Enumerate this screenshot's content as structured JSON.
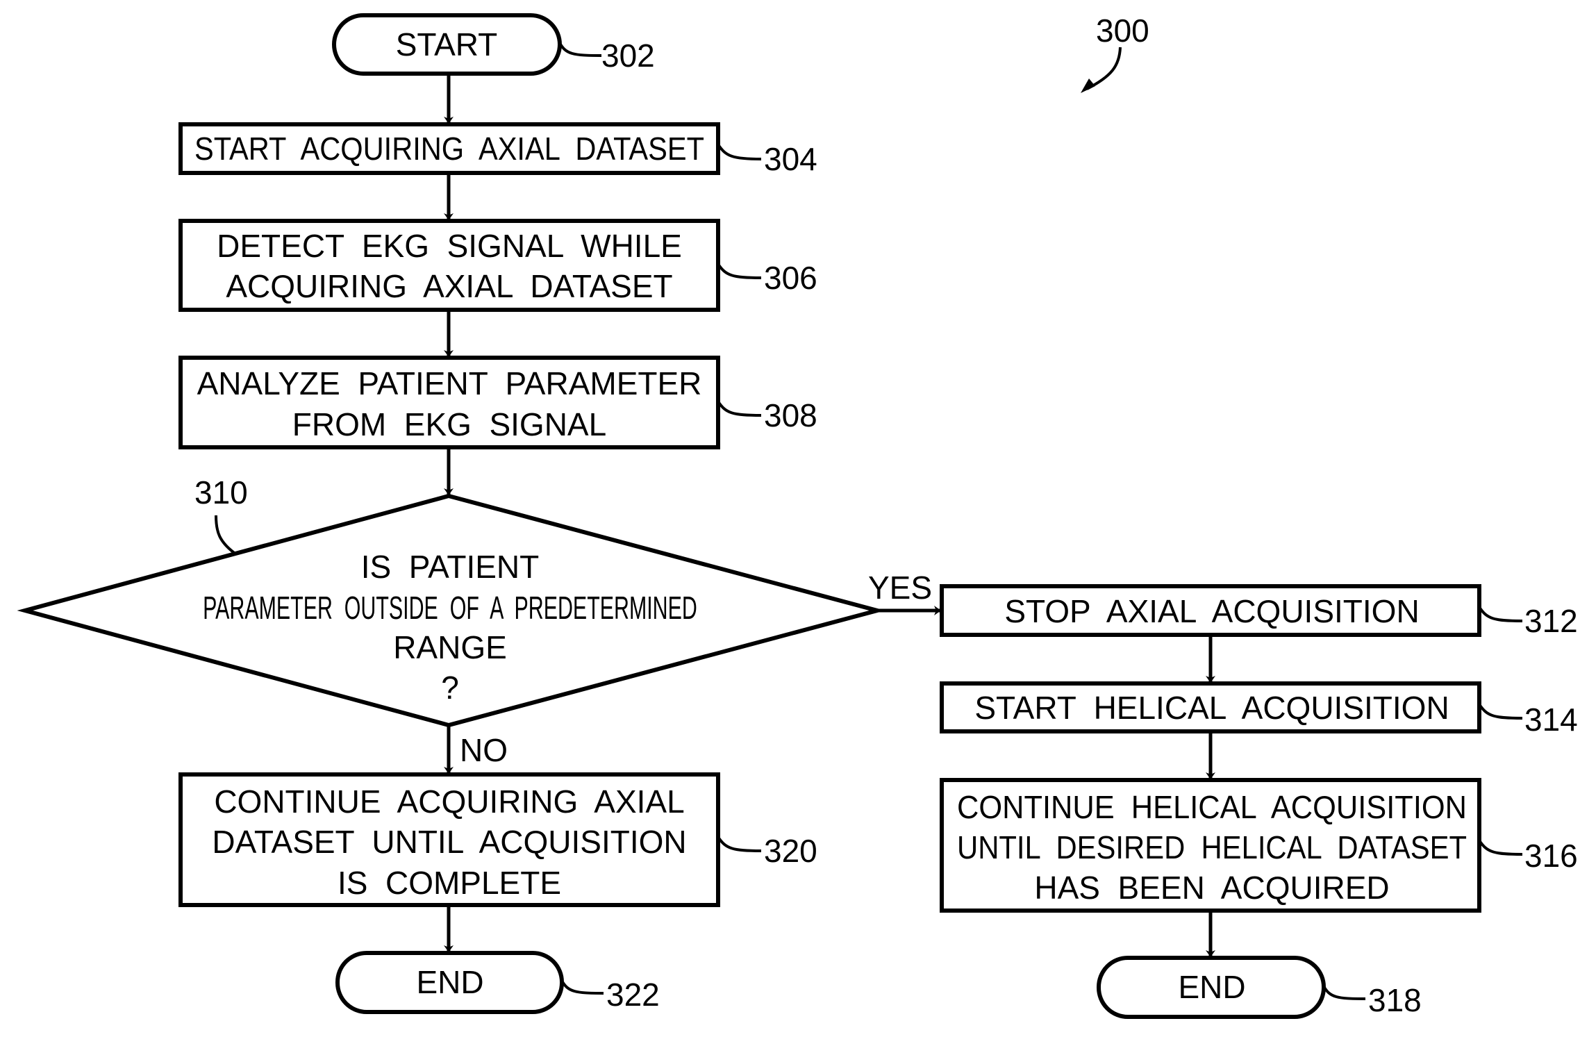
{
  "figure": {
    "ref": "300"
  },
  "nodes": {
    "start": {
      "ref": "302",
      "lines": [
        "START"
      ]
    },
    "acquire_axial": {
      "ref": "304",
      "lines": [
        "START  ACQUIRING  AXIAL  DATASET"
      ]
    },
    "detect_ekg": {
      "ref": "306",
      "lines": [
        "DETECT  EKG  SIGNAL  WHILE",
        "ACQUIRING  AXIAL  DATASET"
      ]
    },
    "analyze": {
      "ref": "308",
      "lines": [
        "ANALYZE  PATIENT  PARAMETER",
        "FROM  EKG  SIGNAL"
      ]
    },
    "decision": {
      "ref": "310",
      "lines": [
        "IS  PATIENT",
        "PARAMETER  OUTSIDE  OF  A  PREDETERMINED",
        "RANGE",
        "?"
      ]
    },
    "stop_axial": {
      "ref": "312",
      "lines": [
        "STOP  AXIAL  ACQUISITION"
      ]
    },
    "start_helical": {
      "ref": "314",
      "lines": [
        "START  HELICAL  ACQUISITION"
      ]
    },
    "continue_helical": {
      "ref": "316",
      "lines": [
        "CONTINUE  HELICAL  ACQUISITION",
        "UNTIL  DESIRED  HELICAL  DATASET",
        "HAS  BEEN  ACQUIRED"
      ]
    },
    "end_right": {
      "ref": "318",
      "lines": [
        "END"
      ]
    },
    "continue_axial": {
      "ref": "320",
      "lines": [
        "CONTINUE  ACQUIRING  AXIAL",
        "DATASET  UNTIL  ACQUISITION",
        "IS  COMPLETE"
      ]
    },
    "end_left": {
      "ref": "322",
      "lines": [
        "END"
      ]
    }
  },
  "edges": {
    "yes_label": "YES",
    "no_label": "NO"
  }
}
